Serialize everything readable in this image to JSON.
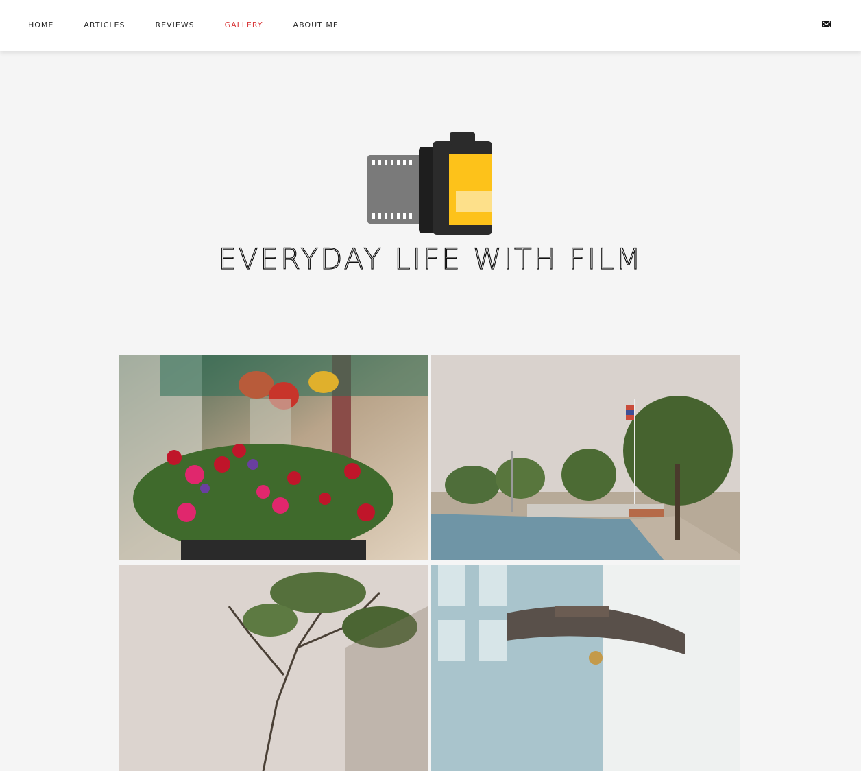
{
  "nav": {
    "items": [
      {
        "label": "HOME"
      },
      {
        "label": "ARTICLES"
      },
      {
        "label": "REVIEWS"
      },
      {
        "label": "GALLERY",
        "active": true
      },
      {
        "label": "ABOUT ME"
      }
    ],
    "icons": {
      "contact": "mail-icon"
    }
  },
  "header": {
    "logo": "film-canister-logo",
    "title": "EVERYDAY LIFE WITH FILM"
  },
  "gallery": {
    "photos": [
      {
        "subject": "hanging-flower-pots"
      },
      {
        "subject": "schoolyard-court-with-flag"
      },
      {
        "subject": "tree-branches-sky"
      },
      {
        "subject": "building-entrance-canopy"
      }
    ]
  },
  "colors": {
    "accent": "#d9383a",
    "background": "#f5f5f5",
    "logo_yellow": "#fdc21a"
  }
}
